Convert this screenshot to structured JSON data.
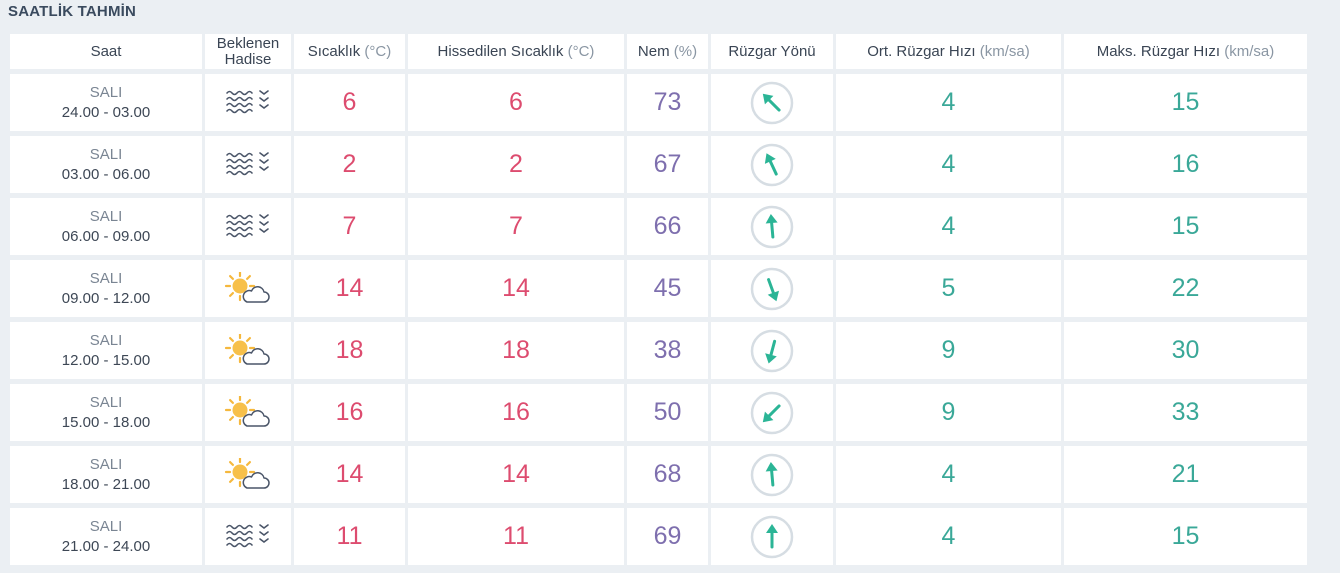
{
  "title": "SAATLİK TAHMİN",
  "colors": {
    "temp": "#dd4c6f",
    "humidity": "#7e6fae",
    "wind": "#3aa898",
    "arrow": "#2bb596",
    "dial": "#d6dde3"
  },
  "headers": {
    "saat": "Saat",
    "hadise_1": "Beklenen",
    "hadise_2": "Hadise",
    "sicaklik": "Sıcaklık",
    "sicaklik_unit": "(°C)",
    "hissedilen": "Hissedilen Sıcaklık",
    "hissedilen_unit": "(°C)",
    "nem": "Nem",
    "nem_unit": "(%)",
    "yon": "Rüzgar Yönü",
    "ort": "Ort. Rüzgar Hızı",
    "ort_unit": "(km/sa)",
    "maks": "Maks. Rüzgar Hızı",
    "maks_unit": "(km/sa)"
  },
  "rows": [
    {
      "day": "SALI",
      "range": "24.00 - 03.00",
      "icon": "fog-icon",
      "temp": "6",
      "feels": "6",
      "humidity": "73",
      "wind_dir_deg": 315,
      "avg": "4",
      "max": "15"
    },
    {
      "day": "SALI",
      "range": "03.00 - 06.00",
      "icon": "fog-icon",
      "temp": "2",
      "feels": "2",
      "humidity": "67",
      "wind_dir_deg": 335,
      "avg": "4",
      "max": "16"
    },
    {
      "day": "SALI",
      "range": "06.00 - 09.00",
      "icon": "fog-icon",
      "temp": "7",
      "feels": "7",
      "humidity": "66",
      "wind_dir_deg": 355,
      "avg": "4",
      "max": "15"
    },
    {
      "day": "SALI",
      "range": "09.00 - 12.00",
      "icon": "partly-cloudy-icon",
      "temp": "14",
      "feels": "14",
      "humidity": "45",
      "wind_dir_deg": 160,
      "avg": "5",
      "max": "22"
    },
    {
      "day": "SALI",
      "range": "12.00 - 15.00",
      "icon": "partly-cloudy-icon",
      "temp": "18",
      "feels": "18",
      "humidity": "38",
      "wind_dir_deg": 195,
      "avg": "9",
      "max": "30"
    },
    {
      "day": "SALI",
      "range": "15.00 - 18.00",
      "icon": "partly-cloudy-icon",
      "temp": "16",
      "feels": "16",
      "humidity": "50",
      "wind_dir_deg": 225,
      "avg": "9",
      "max": "33"
    },
    {
      "day": "SALI",
      "range": "18.00 - 21.00",
      "icon": "partly-cloudy-icon",
      "temp": "14",
      "feels": "14",
      "humidity": "68",
      "wind_dir_deg": 355,
      "avg": "4",
      "max": "21"
    },
    {
      "day": "SALI",
      "range": "21.00 - 24.00",
      "icon": "fog-icon",
      "temp": "11",
      "feels": "11",
      "humidity": "69",
      "wind_dir_deg": 0,
      "avg": "4",
      "max": "15"
    }
  ]
}
